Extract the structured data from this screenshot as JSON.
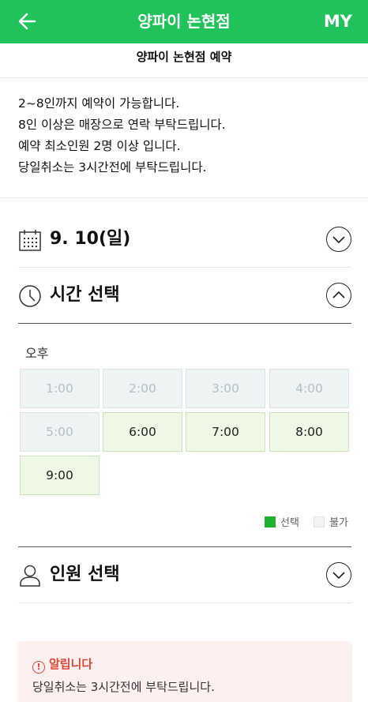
{
  "header": {
    "title": "양파이 논현점",
    "right_label": "MY",
    "color": "#1fc35a"
  },
  "subtitle": "양파이 논현점 예약",
  "notice": [
    "2~8인까지 예약이 가능합니다.",
    "8인 이상은 매장으로 연락 부탁드립니다.",
    "예약 최소인원 2명 이상 입니다.",
    "당일취소는 3시간전에 부탁드립니다."
  ],
  "date_section": {
    "label": "9. 10(일)",
    "icon": "calendar-icon",
    "expanded": false
  },
  "time_section": {
    "label": "시간 선택",
    "icon": "clock-icon",
    "expanded": true,
    "period": "오후",
    "slots": [
      {
        "time": "1:00",
        "available": false
      },
      {
        "time": "2:00",
        "available": false
      },
      {
        "time": "3:00",
        "available": false
      },
      {
        "time": "4:00",
        "available": false
      },
      {
        "time": "5:00",
        "available": false
      },
      {
        "time": "6:00",
        "available": true
      },
      {
        "time": "7:00",
        "available": true
      },
      {
        "time": "8:00",
        "available": true
      },
      {
        "time": "9:00",
        "available": true
      }
    ],
    "legend": {
      "selected": "선택",
      "unavailable": "불가"
    }
  },
  "people_section": {
    "label": "인원 선택",
    "icon": "person-icon",
    "expanded": false
  },
  "alert": {
    "title": "알립니다",
    "body": "당일취소는 3시간전에 부탁드립니다.",
    "color": "#e0473a"
  }
}
